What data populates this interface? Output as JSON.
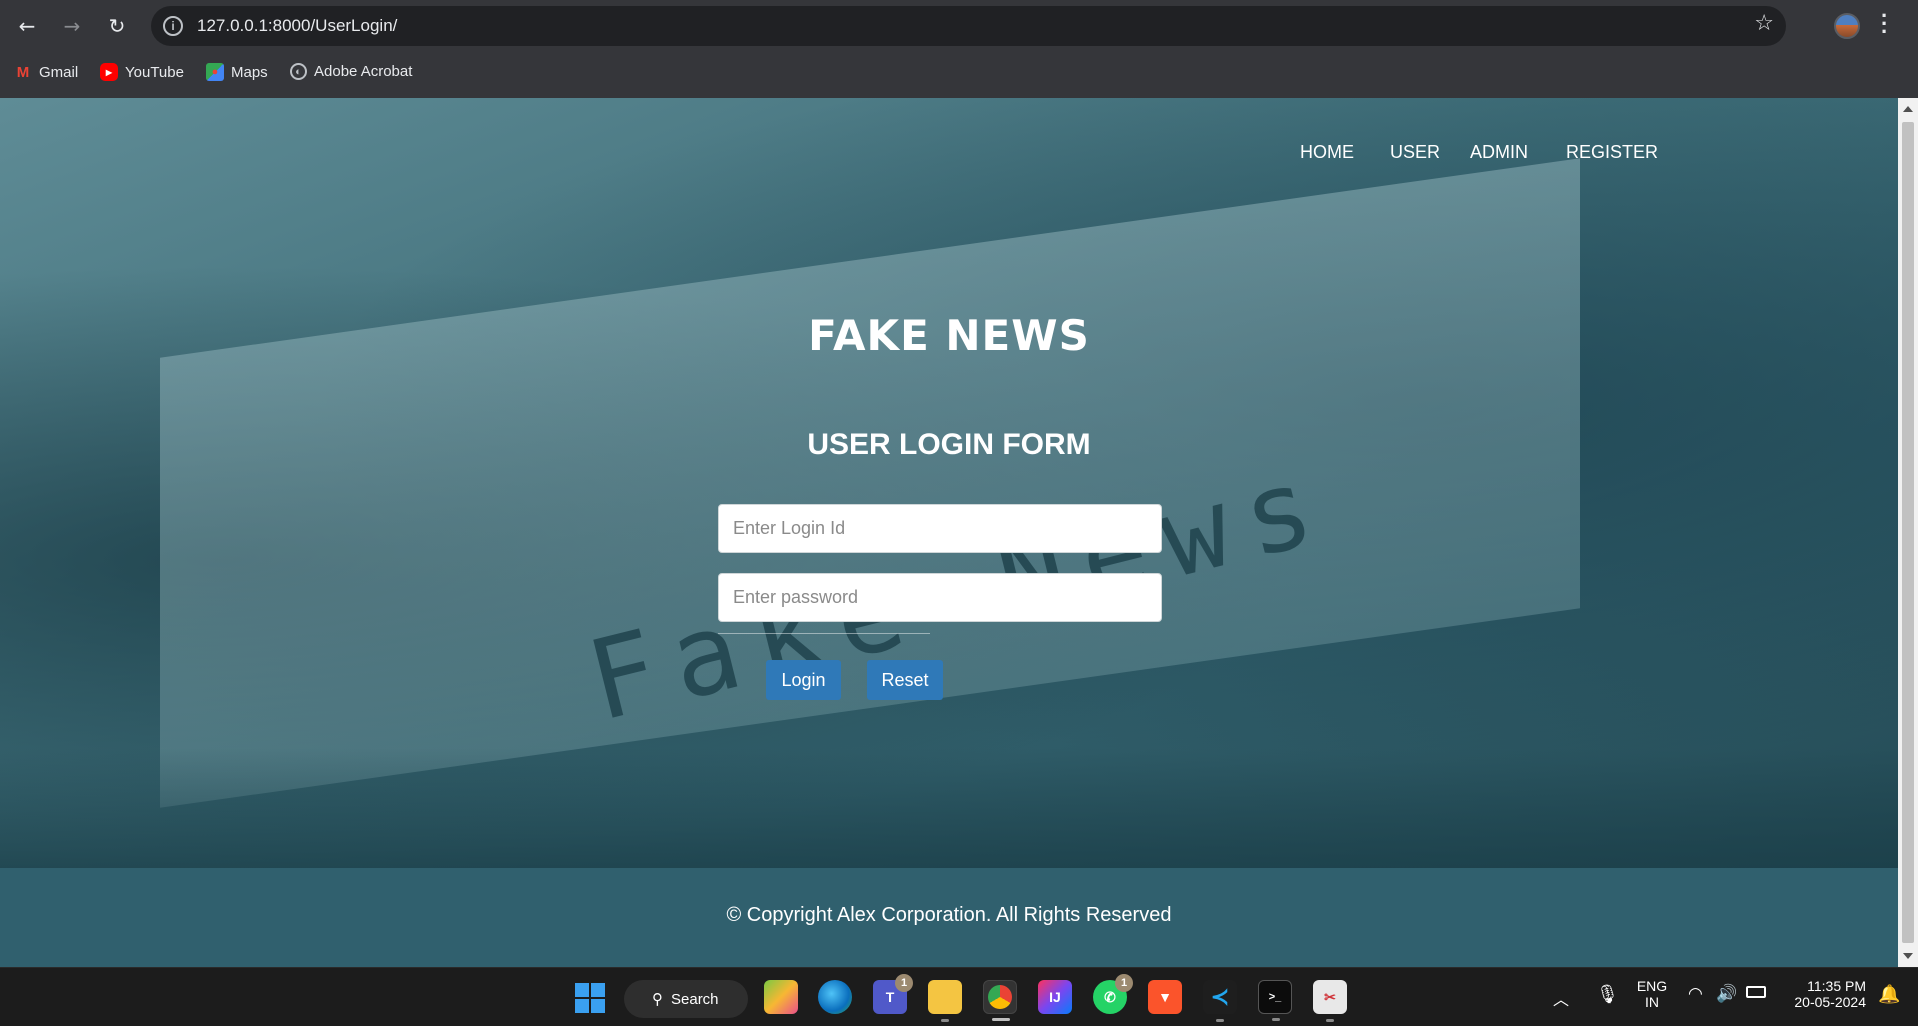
{
  "browser": {
    "url": "127.0.0.1:8000/UserLogin/",
    "bookmarks": [
      {
        "label": "Gmail",
        "icon": "gmail-icon"
      },
      {
        "label": "YouTube",
        "icon": "youtube-icon"
      },
      {
        "label": "Maps",
        "icon": "maps-icon"
      },
      {
        "label": "Adobe Acrobat",
        "icon": "globe-icon"
      }
    ]
  },
  "nav": {
    "home": "HOME",
    "user": "USER",
    "admin": "ADMIN",
    "register": "REGISTER"
  },
  "hero": {
    "brand": "FAKE NEWS",
    "background_text": "Fake News"
  },
  "form": {
    "title": "USER LOGIN FORM",
    "login_placeholder": "Enter Login Id",
    "password_placeholder": "Enter password",
    "login_label": "Login",
    "reset_label": "Reset"
  },
  "footer": {
    "copyright": "© Copyright Alex Corporation. All Rights Reserved"
  },
  "taskbar": {
    "search_label": "Search",
    "teams_badge": "1",
    "whatsapp_badge": "1",
    "language_line1": "ENG",
    "language_line2": "IN",
    "time": "11:35 PM",
    "date": "20-05-2024"
  },
  "colors": {
    "button": "#2f79b8",
    "footer": "#30606e",
    "hero_tint": "#3e6d78"
  }
}
